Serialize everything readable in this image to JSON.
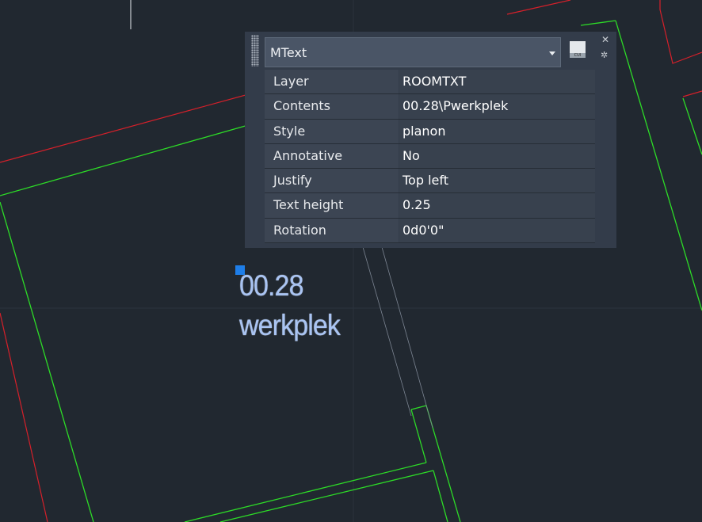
{
  "colors": {
    "background": "#212830",
    "room_outline": "#2ddc27",
    "wall_outline": "#d6202a",
    "mtext": "#a9c4f3",
    "grip": "#1e7ee8",
    "panel": "#333c4a"
  },
  "drawing": {
    "mtext_line1": "00.28",
    "mtext_line2": "werkplek"
  },
  "quick_properties": {
    "object_type": "MText",
    "quick_select_label": "CUI",
    "close_icon": "close-icon",
    "settings_icon": "settings-icon",
    "rows": [
      {
        "name": "Layer",
        "value": "ROOMTXT"
      },
      {
        "name": "Contents",
        "value": "00.28\\Pwerkplek"
      },
      {
        "name": "Style",
        "value": "planon"
      },
      {
        "name": "Annotative",
        "value": "No"
      },
      {
        "name": "Justify",
        "value": "Top left"
      },
      {
        "name": "Text height",
        "value": "0.25"
      },
      {
        "name": "Rotation",
        "value": "0d0'0\""
      }
    ]
  }
}
